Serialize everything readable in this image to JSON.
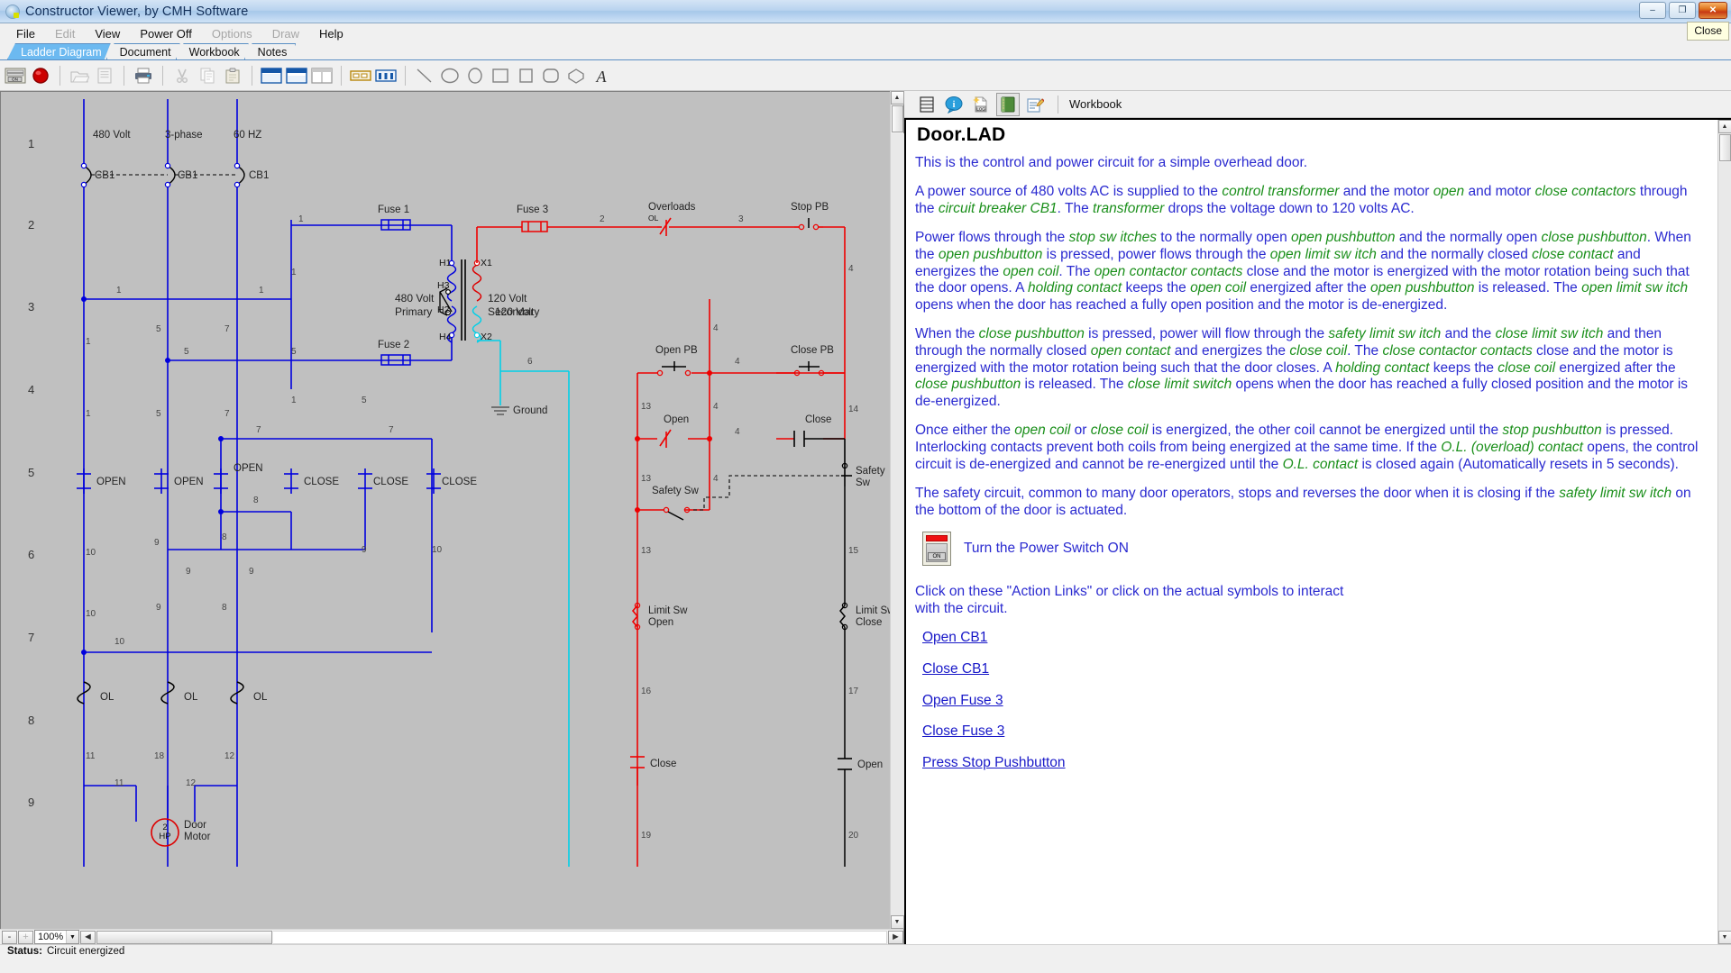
{
  "window": {
    "title": "Constructor Viewer, by CMH Software",
    "app_icon": "app-logo-icon",
    "minimize_label": "–",
    "maximize_label": "❐",
    "close_label": "✕",
    "close_tooltip": "Close"
  },
  "menu": [
    {
      "label": "File",
      "disabled": false
    },
    {
      "label": "Edit",
      "disabled": true
    },
    {
      "label": "View",
      "disabled": false
    },
    {
      "label": "Power Off",
      "disabled": false
    },
    {
      "label": "Options",
      "disabled": true
    },
    {
      "label": "Draw",
      "disabled": true
    },
    {
      "label": "Help",
      "disabled": false
    }
  ],
  "tabs": [
    {
      "label": "Ladder Diagram",
      "active": true
    },
    {
      "label": "Document",
      "active": false
    },
    {
      "label": "Workbook",
      "active": false
    },
    {
      "label": "Notes",
      "active": false
    }
  ],
  "toolbar": {
    "power_switch_label": "ON",
    "icons": [
      "power-switch-icon",
      "indicator-lamp-icon",
      "open-file-icon",
      "save-icon",
      "print-icon",
      "cut-icon",
      "copy-icon",
      "paste-icon",
      "layout-top-icon",
      "layout-bottom-icon",
      "layout-split-icon",
      "terminal-strip-icon",
      "wiring-diagram-icon",
      "line-tool-icon",
      "ellipse-tool-icon",
      "arc-tool-icon",
      "rectangle-tool-icon",
      "square-tool-icon",
      "rounded-rect-tool-icon",
      "polygon-tool-icon",
      "text-tool-icon"
    ]
  },
  "canvas": {
    "rung_numbers": [
      "1",
      "2",
      "3",
      "4",
      "5",
      "6",
      "7",
      "8",
      "9"
    ],
    "colors": {
      "power_wire": "#0000dd",
      "control_wire": "#ee0000",
      "secondary_wire": "#00d0e8",
      "background": "#c0c0c0",
      "black": "#000000"
    },
    "labels": {
      "supply": [
        "480 Volt",
        "3-phase",
        "60 HZ"
      ],
      "breakers": [
        "CB1",
        "CB1",
        "CB1"
      ],
      "fuse1": "Fuse 1",
      "fuse2": "Fuse 2",
      "fuse3": "Fuse 3",
      "primary": "480 Volt\nPrimary",
      "primary_line1": "480 Volt",
      "primary_line2": "Primary",
      "secondary_line1": "120 Volt",
      "secondary_line2": "Secondary",
      "transformer_taps": [
        "H1",
        "H3",
        "H2",
        "H4",
        "X1",
        "X2"
      ],
      "ground": "Ground",
      "overloads": "Overloads",
      "overload_contact": "OL",
      "stop_pb": "Stop  PB",
      "open_pb": "Open  PB",
      "close_pb": "Close  PB",
      "open_coil": "Open",
      "close_coil": "Close",
      "open_contacts": [
        "OPEN",
        "OPEN",
        "OPEN"
      ],
      "close_contacts": [
        "CLOSE",
        "CLOSE",
        "CLOSE"
      ],
      "open_nc": "Open",
      "close_nc": "Close",
      "safety_sw": "Safety  Sw",
      "safety_sw_right_l1": "Safety",
      "safety_sw_right_l2": "Sw",
      "limit_sw_open_l1": "Limit Sw",
      "limit_sw_open_l2": "Open",
      "limit_sw_close_l1": "Limit Sw",
      "limit_sw_close_l2": "Close",
      "ol_contacts": [
        "OL",
        "OL",
        "OL"
      ],
      "motor_hp": "2",
      "motor_hp_unit": "HP",
      "motor_name_l1": "Door",
      "motor_name_l2": "Motor"
    },
    "wire_numbers": {
      "power": [
        "1",
        "1",
        "5",
        "7",
        "1",
        "5",
        "7",
        "1",
        "5",
        "7",
        "1",
        "5",
        "7",
        "8",
        "9",
        "10",
        "9",
        "8",
        "9",
        "10",
        "10",
        "9",
        "8",
        "10",
        "11",
        "18",
        "12",
        "11",
        "12"
      ],
      "control": [
        "1",
        "2",
        "3",
        "4",
        "4",
        "4",
        "4",
        "13",
        "13",
        "13",
        "13",
        "14",
        "15",
        "16",
        "17",
        "19",
        "20",
        "5",
        "6"
      ]
    }
  },
  "scroll": {
    "up_arrow": "▲",
    "down_arrow": "▼",
    "left_arrow": "◄",
    "right_arrow": "►"
  },
  "zoom_bar": {
    "minus": "-",
    "plus": "+",
    "level": "100%",
    "dropdown_arrow": "▼",
    "left_arrow": "◄",
    "right_arrow": "►"
  },
  "status": {
    "label": "Status:",
    "message": "Circuit energized"
  },
  "workbook": {
    "toolbar_icons": [
      "ladder-diagram-icon",
      "info-balloon-icon",
      "log-file-icon",
      "workbook-icon",
      "notes-edit-icon"
    ],
    "toolbar_label": "Workbook",
    "title": "Door.LAD",
    "paragraphs": [
      {
        "id": "p1",
        "runs": [
          {
            "t": "This is the control and power circuit for a simple overhead door.",
            "em": false
          }
        ]
      },
      {
        "id": "p2",
        "runs": [
          {
            "t": "A power source of  480 volts AC is supplied to the ",
            "em": false
          },
          {
            "t": "control transformer",
            "em": true
          },
          {
            "t": " and the motor ",
            "em": false
          },
          {
            "t": "open",
            "em": true
          },
          {
            "t": " and motor ",
            "em": false
          },
          {
            "t": "close contactors",
            "em": true
          },
          {
            "t": " through the ",
            "em": false
          },
          {
            "t": "circuit breaker CB1",
            "em": true
          },
          {
            "t": ". The ",
            "em": false
          },
          {
            "t": "transformer",
            "em": true
          },
          {
            "t": " drops the voltage down to 120 volts AC.",
            "em": false
          }
        ]
      },
      {
        "id": "p3",
        "runs": [
          {
            "t": "Power flows through the ",
            "em": false
          },
          {
            "t": "stop sw itches",
            "em": true
          },
          {
            "t": " to the normally open ",
            "em": false
          },
          {
            "t": "open pushbutton",
            "em": true
          },
          {
            "t": " and the normally open ",
            "em": false
          },
          {
            "t": "close pushbutton",
            "em": true
          },
          {
            "t": ". When the ",
            "em": false
          },
          {
            "t": "open pushbutton",
            "em": true
          },
          {
            "t": " is pressed, power flows through the ",
            "em": false
          },
          {
            "t": "open limit sw itch",
            "em": true
          },
          {
            "t": " and the normally closed ",
            "em": false
          },
          {
            "t": "close contact",
            "em": true
          },
          {
            "t": " and energizes the ",
            "em": false
          },
          {
            "t": "open coil",
            "em": true
          },
          {
            "t": ". The ",
            "em": false
          },
          {
            "t": "open contactor contacts",
            "em": true
          },
          {
            "t": " close and the motor is energized with the motor rotation being such that the door opens. A ",
            "em": false
          },
          {
            "t": "holding contact",
            "em": true
          },
          {
            "t": " keeps the ",
            "em": false
          },
          {
            "t": "open coil",
            "em": true
          },
          {
            "t": " energized after the ",
            "em": false
          },
          {
            "t": "open pushbutton",
            "em": true
          },
          {
            "t": " is released. The ",
            "em": false
          },
          {
            "t": "open limit sw itch",
            "em": true
          },
          {
            "t": " opens when the door has reached a fully open position and the motor is de-energized.",
            "em": false
          }
        ]
      },
      {
        "id": "p4",
        "runs": [
          {
            "t": "When the ",
            "em": false
          },
          {
            "t": "close pushbutton",
            "em": true
          },
          {
            "t": " is pressed, power will flow through the ",
            "em": false
          },
          {
            "t": "safety limit sw itch",
            "em": true
          },
          {
            "t": " and the ",
            "em": false
          },
          {
            "t": "close limit sw itch",
            "em": true
          },
          {
            "t": " and then through the normally closed ",
            "em": false
          },
          {
            "t": "open contact",
            "em": true
          },
          {
            "t": " and energizes the ",
            "em": false
          },
          {
            "t": "close coil",
            "em": true
          },
          {
            "t": ". The ",
            "em": false
          },
          {
            "t": "close contactor contacts",
            "em": true
          },
          {
            "t": " close and the motor is energized with the motor rotation being such that the door closes. A ",
            "em": false
          },
          {
            "t": "holding contact",
            "em": true
          },
          {
            "t": " keeps the ",
            "em": false
          },
          {
            "t": "close coil",
            "em": true
          },
          {
            "t": " energized after the ",
            "em": false
          },
          {
            "t": "close pushbutton",
            "em": true
          },
          {
            "t": " is released. The ",
            "em": false
          },
          {
            "t": "close limit switch",
            "em": true
          },
          {
            "t": " opens when the door has reached a fully closed position and the motor is de-energized.",
            "em": false
          }
        ]
      },
      {
        "id": "p5",
        "runs": [
          {
            "t": "Once either the ",
            "em": false
          },
          {
            "t": "open coil",
            "em": true
          },
          {
            "t": " or ",
            "em": false
          },
          {
            "t": "close coil",
            "em": true
          },
          {
            "t": " is energized, the other coil cannot be energized until the ",
            "em": false
          },
          {
            "t": "stop pushbutton",
            "em": true
          },
          {
            "t": " is pressed. Interlocking contacts prevent both coils from being energized at the same time. If the ",
            "em": false
          },
          {
            "t": "O.L. (overload) contact",
            "em": true
          },
          {
            "t": " opens, the control circuit is de-energized and cannot be re-energized until the ",
            "em": false
          },
          {
            "t": "O.L. contact",
            "em": true
          },
          {
            "t": " is closed again (Automatically resets in 5 seconds).",
            "em": false
          }
        ]
      },
      {
        "id": "p6",
        "runs": [
          {
            "t": "The safety circuit, common to many door operators, stops and reverses the door when it is closing if the ",
            "em": false
          },
          {
            "t": "safety limit sw itch",
            "em": true
          },
          {
            "t": " on the bottom of the door is actuated.",
            "em": false
          }
        ]
      }
    ],
    "power_action": {
      "icon": "power-switch-icon",
      "switch_text": "ON",
      "label": "Turn the Power Switch ON"
    },
    "instructions_l1": "Click on these \"Action Links\" or click on the actual symbols to interact",
    "instructions_l2": " with the circuit.",
    "action_links": [
      "Open CB1 ",
      "Close CB1 ",
      "Open Fuse 3 ",
      "Close Fuse 3 ",
      "Press Stop Pushbutton"
    ]
  }
}
